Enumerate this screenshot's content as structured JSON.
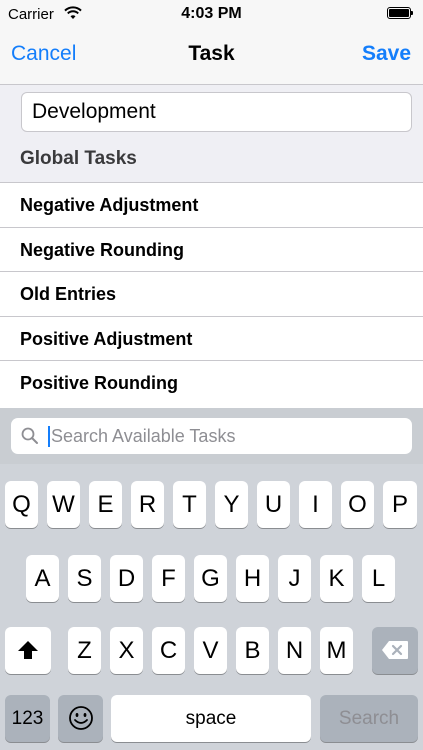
{
  "status_bar": {
    "carrier": "Carrier",
    "time": "4:03 PM"
  },
  "navbar": {
    "cancel_label": "Cancel",
    "title": "Task",
    "save_label": "Save"
  },
  "task_name": {
    "value": "Development"
  },
  "section": {
    "title": "Global Tasks"
  },
  "list": {
    "items": [
      {
        "label": "Negative Adjustment"
      },
      {
        "label": "Negative Rounding"
      },
      {
        "label": "Old Entries"
      },
      {
        "label": "Positive Adjustment"
      },
      {
        "label": "Positive Rounding"
      }
    ]
  },
  "search": {
    "placeholder": "Search Available Tasks"
  },
  "keyboard": {
    "row1": [
      "Q",
      "W",
      "E",
      "R",
      "T",
      "Y",
      "U",
      "I",
      "O",
      "P"
    ],
    "row2": [
      "A",
      "S",
      "D",
      "F",
      "G",
      "H",
      "J",
      "K",
      "L"
    ],
    "row3": [
      "Z",
      "X",
      "C",
      "V",
      "B",
      "N",
      "M"
    ],
    "numbers_label": "123",
    "space_label": "space",
    "search_label": "Search"
  },
  "colors": {
    "accent": "#147efb",
    "keyboard_bg": "#cfd3d9",
    "dark_key": "#abb2bb"
  }
}
